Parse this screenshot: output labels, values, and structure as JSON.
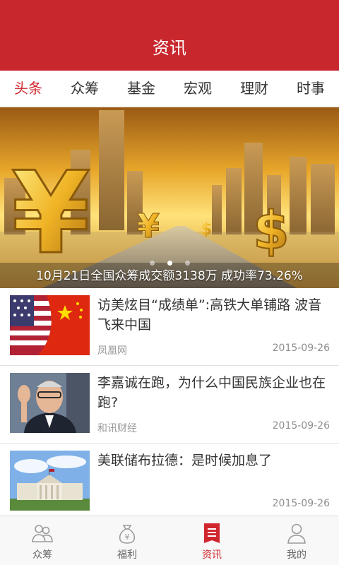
{
  "header": {
    "title": "资讯"
  },
  "category_tabs": [
    {
      "label": "头条",
      "active": true
    },
    {
      "label": "众筹",
      "active": false
    },
    {
      "label": "基金",
      "active": false
    },
    {
      "label": "宏观",
      "active": false
    },
    {
      "label": "理财",
      "active": false
    },
    {
      "label": "时事",
      "active": false
    }
  ],
  "banner": {
    "caption": "10月21日全国众筹成交额3138万 成功率73.26%",
    "slide_count": 3,
    "active_slide": 1
  },
  "news": [
    {
      "headline": "访美炫目“成绩单”:高铁大单铺路 波音飞来中国",
      "source": "凤凰网",
      "date": "2015-09-26",
      "image": "us-china-flags"
    },
    {
      "headline": "李嘉诚在跑，为什么中国民族企业也在跑?",
      "source": "和讯财经",
      "date": "2015-09-26",
      "image": "businessman-portrait"
    },
    {
      "headline": "美联储布拉德：是时候加息了",
      "source": "",
      "date": "2015-09-26",
      "image": "federal-reserve-building"
    }
  ],
  "bottom_nav": [
    {
      "label": "众筹",
      "icon": "crowd-icon",
      "active": false
    },
    {
      "label": "福利",
      "icon": "money-bag-icon",
      "active": false
    },
    {
      "label": "资讯",
      "icon": "news-icon",
      "active": true
    },
    {
      "label": "我的",
      "icon": "user-icon",
      "active": false
    }
  ],
  "colors": {
    "brand_red": "#c8272d",
    "active_text": "#d0262d",
    "text": "#333333",
    "muted": "#9a9a9a"
  }
}
